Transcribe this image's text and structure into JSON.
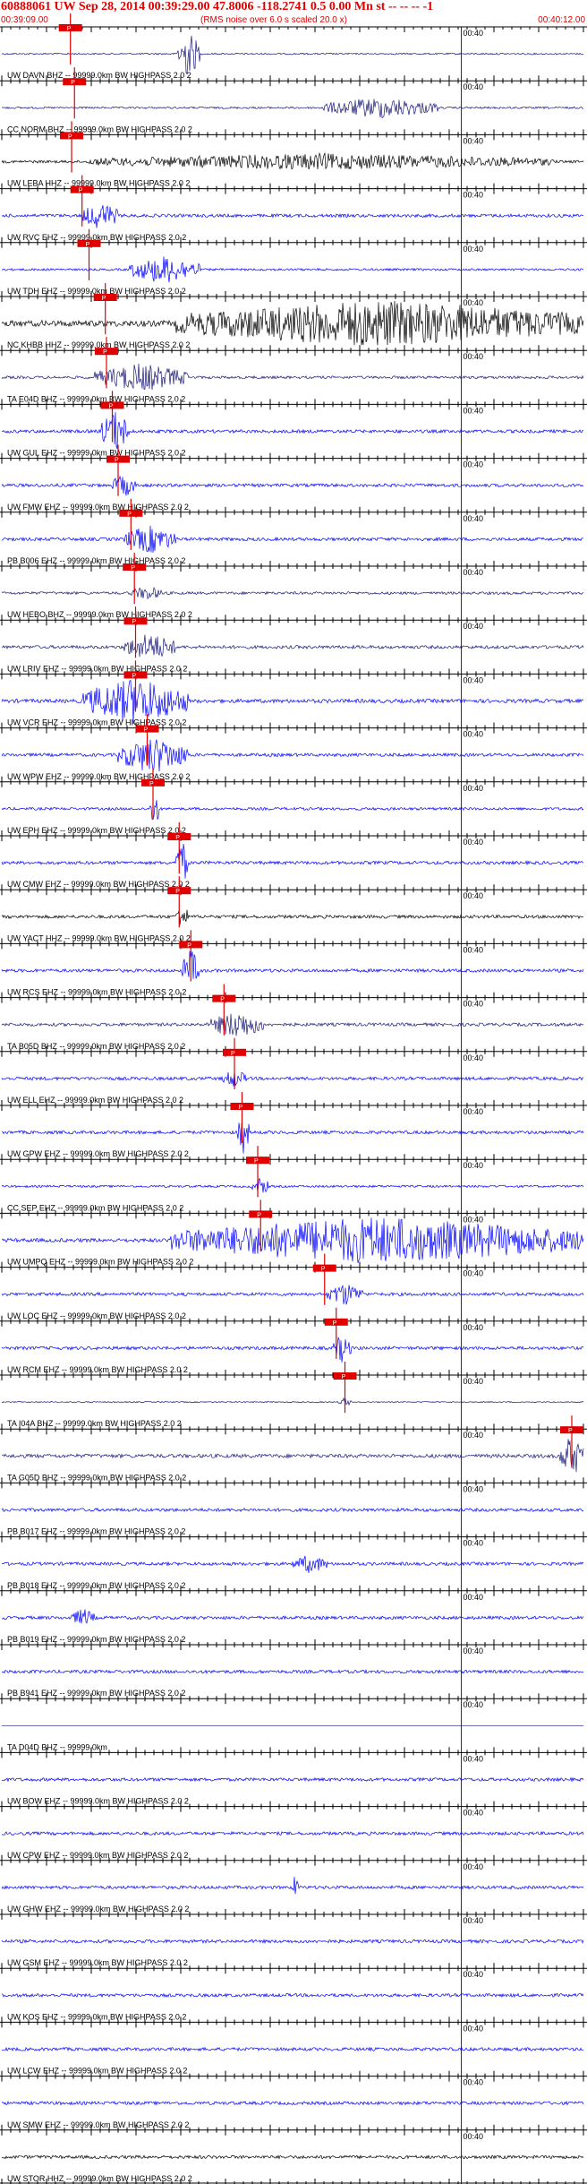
{
  "header": {
    "title": "60888061 UW Sep 28, 2014 00:39:29.00   47.8006 -118.2741  0.5 0.00 Mn st -- -- --  -1",
    "start_time": "00:39:09.00",
    "note": "(RMS noise over 6.0 s scaled 20.0 x)",
    "end_time": "00:40:12.00"
  },
  "chart_data": {
    "type": "line",
    "title": "60888061 UW Sep 28, 2014 00:39:29.00   47.8006 -118.2741  0.5 0.00 Mn st -- -- --  -1",
    "x_range": [
      "00:39:09.00",
      "00:40:12.00"
    ],
    "x_tick_label": "00:40",
    "grid": true,
    "colors": {
      "black": "#000000",
      "blue": "#0000ff",
      "navy": "#1a1a7a",
      "pick": "#e00000"
    },
    "pick_label": "P",
    "traces": [
      {
        "label": "UW DAVN BHZ -- 99999.0km BW  HIGHPASS  2.0  2",
        "color": "#1a1a7a",
        "noise": 0.15,
        "pick": 0.118,
        "burst": [
          0.3,
          0.34,
          1.0
        ]
      },
      {
        "label": "CC NORM BHZ -- 99999.0km BW  HIGHPASS  2.0  2",
        "color": "#1a1a7a",
        "noise": 0.18,
        "pick": 0.125,
        "burst": [
          0.55,
          0.75,
          0.45
        ]
      },
      {
        "label": "UW LEBA HHZ -- 99999.0km BW  HIGHPASS  2.0  2",
        "color": "#000000",
        "noise": 0.25,
        "pick": 0.12,
        "burst": [
          0.15,
          0.95,
          0.35
        ]
      },
      {
        "label": "UW RVC EHZ -- 99999.0km BW  HIGHPASS  2.0  2",
        "color": "#0000ff",
        "noise": 0.3,
        "pick": 0.138,
        "burst": [
          0.14,
          0.2,
          0.6
        ]
      },
      {
        "label": "UW TDH EHZ -- 99999.0km BW  HIGHPASS  2.0  2",
        "color": "#0000ff",
        "noise": 0.2,
        "pick": 0.15,
        "burst": [
          0.22,
          0.34,
          0.6
        ]
      },
      {
        "label": "NC KHBB HHZ -- 99999.0km BW  HIGHPASS  2.0  2",
        "color": "#000000",
        "noise": 0.55,
        "pick": 0.178,
        "burst": [
          0.3,
          1.0,
          1.0
        ]
      },
      {
        "label": "TA E04D BHZ -- 99999.0km BW  HIGHPASS  2.0  2",
        "color": "#1a1a7a",
        "noise": 0.25,
        "pick": 0.18,
        "burst": [
          0.16,
          0.32,
          0.6
        ]
      },
      {
        "label": "UW GUL EHZ -- 99999.0km BW  HIGHPASS  2.0  2",
        "color": "#0000ff",
        "noise": 0.3,
        "pick": 0.19,
        "burst": [
          0.17,
          0.22,
          0.9
        ]
      },
      {
        "label": "UW FMW EHZ -- 99999.0km BW  HIGHPASS  2.0  2",
        "color": "#0000ff",
        "noise": 0.3,
        "pick": 0.2,
        "burst": [
          0.19,
          0.23,
          0.5
        ]
      },
      {
        "label": "PB B006 EHZ -- 99999.0km BW  HIGHPASS  2.0  2",
        "color": "#0000ff",
        "noise": 0.3,
        "pick": 0.222,
        "burst": [
          0.21,
          0.3,
          0.6
        ]
      },
      {
        "label": "UW HEBO BHZ -- 99999.0km BW  HIGHPASS  2.0  2",
        "color": "#1a1a7a",
        "noise": 0.25,
        "pick": 0.228,
        "burst": [
          0.22,
          0.28,
          0.3
        ]
      },
      {
        "label": "UW LRIV EHZ -- 99999.0km BW  HIGHPASS  2.0  2",
        "color": "#1a1a7a",
        "noise": 0.3,
        "pick": 0.23,
        "burst": [
          0.21,
          0.3,
          0.6
        ]
      },
      {
        "label": "UW VCR EHZ -- 99999.0km BW  HIGHPASS  2.0  2",
        "color": "#0000ff",
        "noise": 0.35,
        "pick": 0.23,
        "burst": [
          0.14,
          0.32,
          1.0
        ]
      },
      {
        "label": "UW WPW EHZ -- 99999.0km BW  HIGHPASS  2.0  2",
        "color": "#0000ff",
        "noise": 0.3,
        "pick": 0.25,
        "burst": [
          0.2,
          0.32,
          0.8
        ]
      },
      {
        "label": "UW EPH EHZ -- 99999.0km BW  HIGHPASS  2.0  2",
        "color": "#0000ff",
        "noise": 0.25,
        "pick": 0.26,
        "burst": [
          0.255,
          0.27,
          0.9
        ]
      },
      {
        "label": "UW CMW EHZ -- 99999.0km BW  HIGHPASS  2.0  2",
        "color": "#0000ff",
        "noise": 0.3,
        "pick": 0.305,
        "burst": [
          0.3,
          0.32,
          1.0
        ]
      },
      {
        "label": "UW YACT HHZ -- 99999.0km BW  HIGHPASS  2.0  2",
        "color": "#000000",
        "noise": 0.3,
        "pick": 0.305,
        "burst": [
          0.3,
          0.32,
          0.6
        ]
      },
      {
        "label": "UW RCS EHZ -- 99999.0km BW  HIGHPASS  2.0  2",
        "color": "#0000ff",
        "noise": 0.3,
        "pick": 0.325,
        "burst": [
          0.31,
          0.34,
          0.9
        ]
      },
      {
        "label": "TA B05D BHZ -- 99999.0km BW  HIGHPASS  2.0  2",
        "color": "#1a1a7a",
        "noise": 0.3,
        "pick": 0.382,
        "burst": [
          0.36,
          0.45,
          0.6
        ]
      },
      {
        "label": "UW ELL EHZ -- 99999.0km BW  HIGHPASS  2.0  2",
        "color": "#0000ff",
        "noise": 0.3,
        "pick": 0.4,
        "burst": [
          0.38,
          0.42,
          0.4
        ]
      },
      {
        "label": "UW GPW EHZ -- 99999.0km BW  HIGHPASS  2.0  2",
        "color": "#0000ff",
        "noise": 0.3,
        "pick": 0.413,
        "burst": [
          0.405,
          0.425,
          0.9
        ]
      },
      {
        "label": "CC SEP EHZ -- 99999.0km BW  HIGHPASS  2.0  2",
        "color": "#0000ff",
        "noise": 0.2,
        "pick": 0.44,
        "burst": [
          0.43,
          0.46,
          0.4
        ]
      },
      {
        "label": "UW UMPQ EHZ -- 99999.0km BW  HIGHPASS  2.0  2",
        "color": "#0000ff",
        "noise": 0.35,
        "pick": 0.445,
        "burst": [
          0.29,
          1.0,
          1.0
        ]
      },
      {
        "label": "UW LOC EHZ -- 99999.0km BW  HIGHPASS  2.0  2",
        "color": "#0000ff",
        "noise": 0.3,
        "pick": 0.555,
        "burst": [
          0.56,
          0.62,
          0.5
        ]
      },
      {
        "label": "UW RCM EHZ -- 99999.0km BW  HIGHPASS  2.0  2",
        "color": "#0000ff",
        "noise": 0.3,
        "pick": 0.575,
        "burst": [
          0.57,
          0.6,
          0.6
        ]
      },
      {
        "label": "TA I04A BHZ -- 99999.0km BW  HIGHPASS  2.0  2",
        "color": "#1a1a7a",
        "noise": 0.1,
        "pick": 0.59,
        "burst": [
          0.58,
          0.6,
          0.2
        ]
      },
      {
        "label": "TA G05D BHZ -- 99999.0km BW  HIGHPASS  2.0  2",
        "color": "#1a1a7a",
        "noise": 0.35,
        "pick": 0.98,
        "burst": [
          0.96,
          1.0,
          0.9
        ]
      },
      {
        "label": "PB B017 EHZ -- 99999.0km BW  HIGHPASS  2.0  2",
        "color": "#0000ff",
        "noise": 0.3,
        "pick": null,
        "burst": null
      },
      {
        "label": "PB B018 EHZ -- 99999.0km BW  HIGHPASS  2.0  2",
        "color": "#0000ff",
        "noise": 0.3,
        "pick": null,
        "burst": [
          0.5,
          0.56,
          0.4
        ]
      },
      {
        "label": "PB B019 EHZ -- 99999.0km BW  HIGHPASS  2.0  2",
        "color": "#0000ff",
        "noise": 0.3,
        "pick": null,
        "burst": [
          0.12,
          0.16,
          0.4
        ]
      },
      {
        "label": "PB B941 EHZ -- 99999.0km BW  HIGHPASS  2.0  2",
        "color": "#0000ff",
        "noise": 0.3,
        "pick": null,
        "burst": null
      },
      {
        "label": "TA D04D BHZ -- 99999.0km",
        "color": "#1a1a7a",
        "noise": 0.0,
        "pick": null,
        "burst": null
      },
      {
        "label": "UW BOW EHZ -- 99999.0km BW  HIGHPASS  2.0  2",
        "color": "#0000ff",
        "noise": 0.3,
        "pick": null,
        "burst": null
      },
      {
        "label": "UW CPW EHZ -- 99999.0km BW  HIGHPASS  2.0  2",
        "color": "#0000ff",
        "noise": 0.3,
        "pick": null,
        "burst": null
      },
      {
        "label": "UW GHW EHZ -- 99999.0km BW  HIGHPASS  2.0  2",
        "color": "#0000ff",
        "noise": 0.3,
        "pick": null,
        "burst": [
          0.5,
          0.51,
          0.6
        ]
      },
      {
        "label": "UW GSM EHZ -- 99999.0km BW  HIGHPASS  2.0  2",
        "color": "#0000ff",
        "noise": 0.3,
        "pick": null,
        "burst": null
      },
      {
        "label": "UW KOS EHZ -- 99999.0km BW  HIGHPASS  2.0  2",
        "color": "#0000ff",
        "noise": 0.3,
        "pick": null,
        "burst": null
      },
      {
        "label": "UW LCW EHZ -- 99999.0km BW  HIGHPASS  2.0  2",
        "color": "#0000ff",
        "noise": 0.3,
        "pick": null,
        "burst": null
      },
      {
        "label": "UW SMW EHZ -- 99999.0km BW  HIGHPASS  2.0  2",
        "color": "#0000ff",
        "noise": 0.3,
        "pick": null,
        "burst": null
      },
      {
        "label": "UW STOR HHZ -- 99999.0km BW  HIGHPASS  2.0  2",
        "color": "#000000",
        "noise": 0.3,
        "pick": null,
        "burst": null
      }
    ]
  }
}
